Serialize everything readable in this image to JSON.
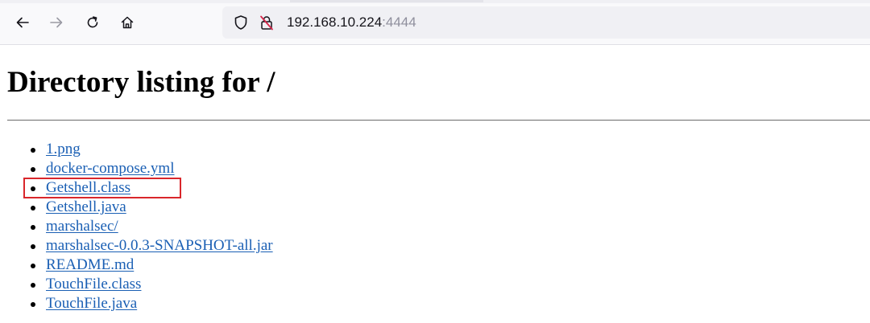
{
  "browser": {
    "nav": {
      "back_icon": "arrow-left-icon",
      "forward_icon": "arrow-right-icon",
      "reload_icon": "reload-icon",
      "home_icon": "home-icon"
    },
    "url": {
      "host": "192.168.10.224",
      "port": ":4444",
      "shield_icon": "shield-icon",
      "insecure_icon": "insecure-lock-icon"
    }
  },
  "page": {
    "title": "Directory listing for /",
    "entries": [
      "1.png",
      "docker-compose.yml",
      "Getshell.class",
      "Getshell.java",
      "marshalsec/",
      "marshalsec-0.0.3-SNAPSHOT-all.jar",
      "README.md",
      "TouchFile.class",
      "TouchFile.java"
    ],
    "highlighted_entry": "Getshell.class",
    "highlight_color": "#d9262b",
    "link_color": "#1a5fb4"
  }
}
